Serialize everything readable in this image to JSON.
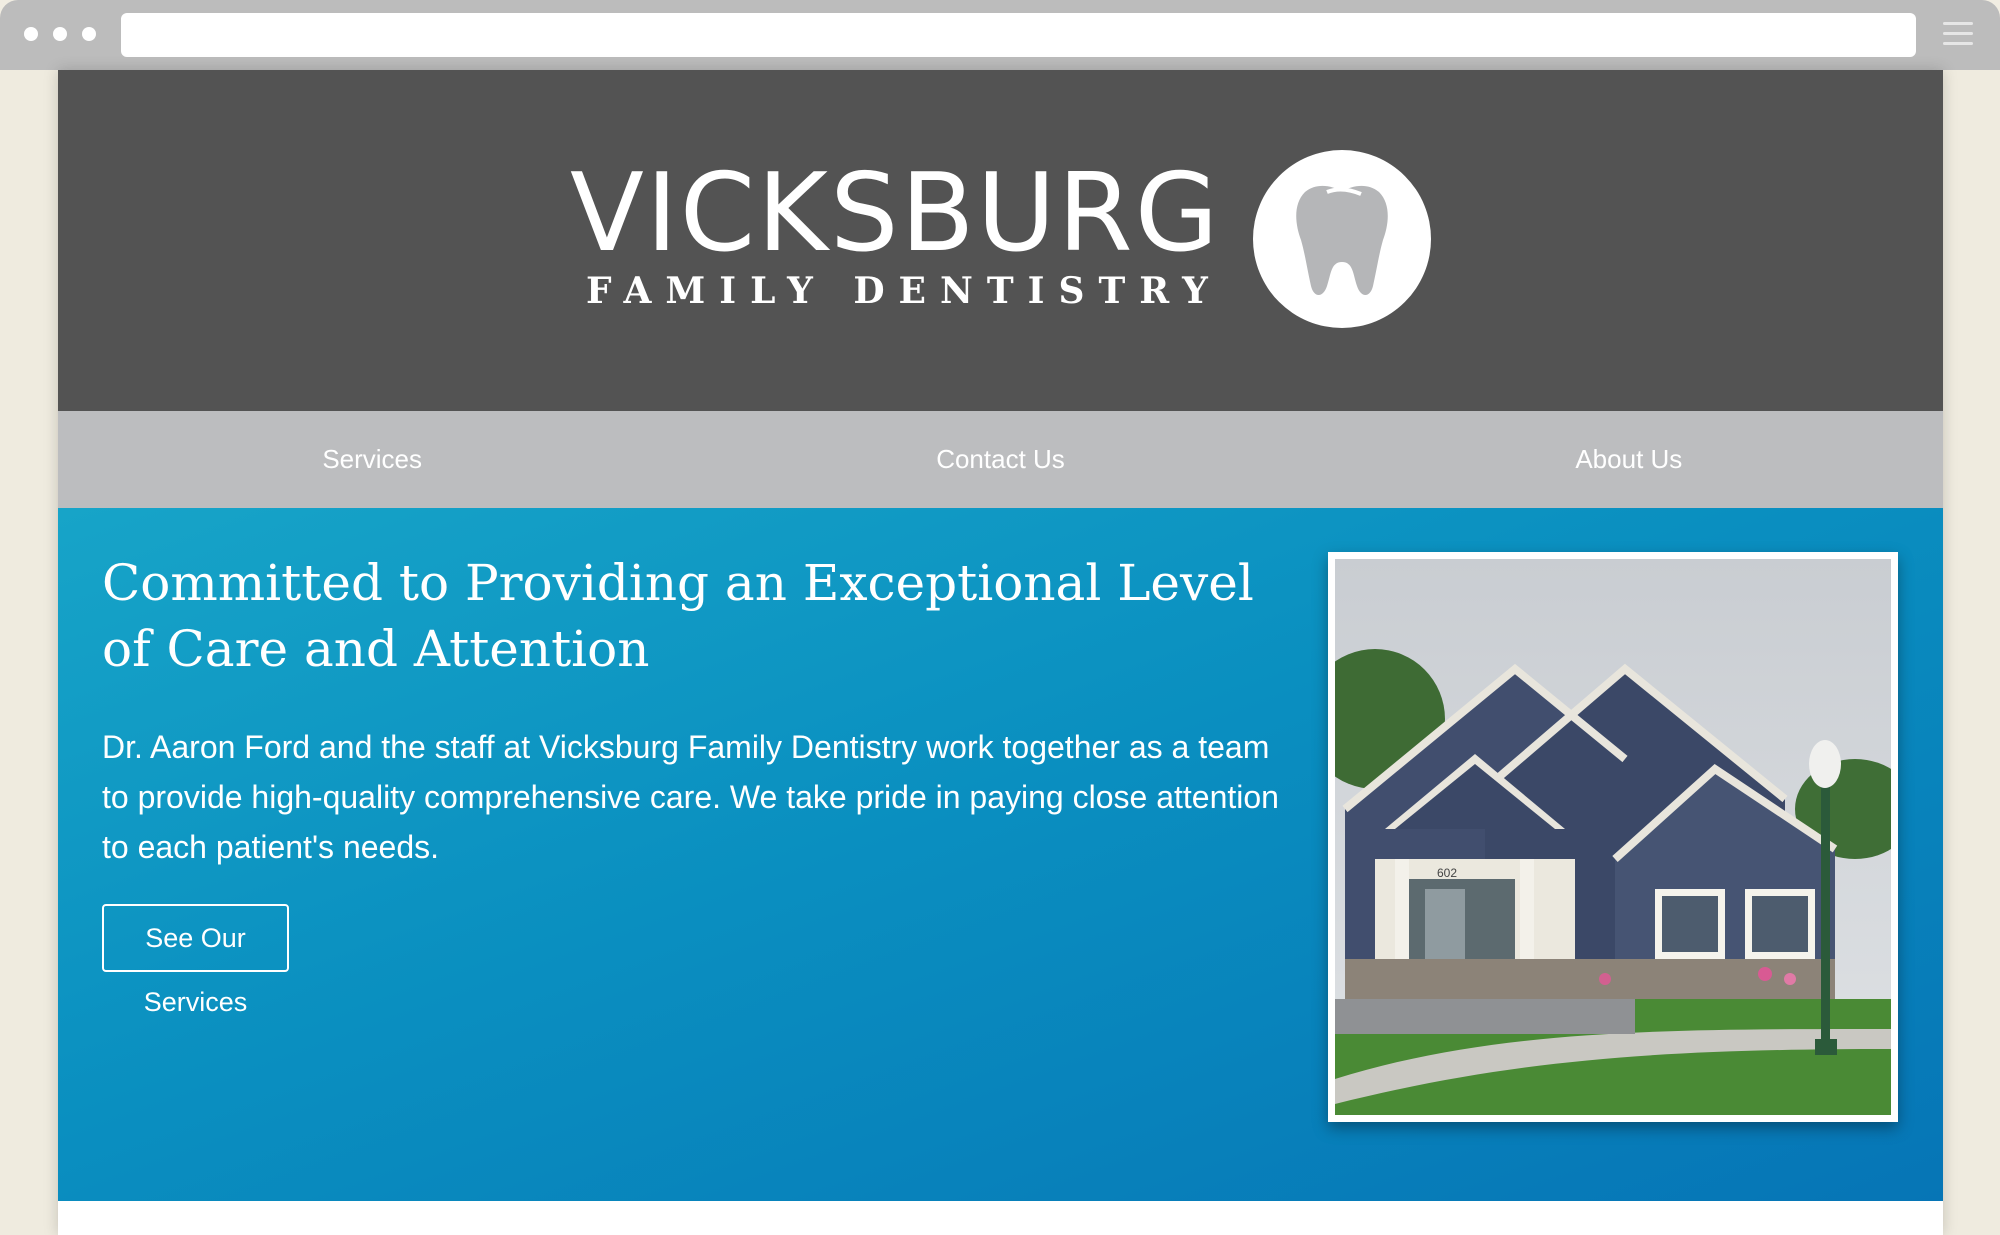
{
  "browser": {
    "url": "",
    "chrome_color": "#bcbcbc"
  },
  "header": {
    "logo_title": "VICKSBURG",
    "logo_subtitle": "FAMILY DENTISTRY",
    "background": "#535353",
    "logo_icon": "tooth-icon"
  },
  "nav": {
    "items": [
      {
        "label": "Services"
      },
      {
        "label": "Contact Us"
      },
      {
        "label": "About Us"
      }
    ],
    "background": "#bcbdbf"
  },
  "hero": {
    "heading": "Committed to Providing an Exceptional Level of Care and Attention",
    "body": "Dr. Aaron Ford and the staff at Vicksburg Family Dentistry work together as a team to provide high-quality comprehensive care. We take pride in paying close attention to each patient's needs.",
    "cta_label": "See Our Services",
    "gradient_start": "#17a4c8",
    "gradient_end": "#0675b6",
    "photo_number_sign": "602"
  }
}
